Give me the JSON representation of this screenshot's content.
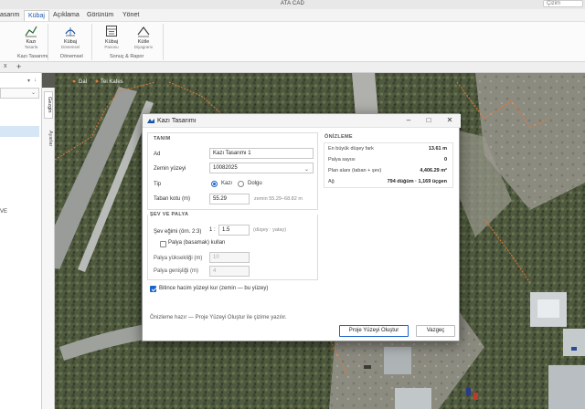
{
  "app": {
    "title": "ATA CAD",
    "search_placeholder": "Çizim"
  },
  "menu": {
    "items": [
      "asarım",
      "Kübaj",
      "Açıklama",
      "Görünüm",
      "Yönet"
    ],
    "active": "Kübaj"
  },
  "ribbon": {
    "buttons": [
      {
        "label": "Kazı",
        "sub": "Tasarla",
        "icon": "excavation-design-icon"
      },
      {
        "label": "Kübaj",
        "sub": "Dönemsel",
        "icon": "periodic-volume-icon"
      },
      {
        "label": "Kübaj",
        "sub": "Panosu",
        "icon": "volume-dashboard-icon"
      },
      {
        "label": "Kütle",
        "sub": "Diyagramı",
        "icon": "mass-haul-icon"
      }
    ],
    "groups": [
      "Kazı Tasarımı",
      "Dönemsel",
      "Sonuç & Rapor"
    ]
  },
  "tabstrip": {
    "close": "x",
    "add": "+"
  },
  "side_tabs": [
    "Gezgin",
    "Ayarlar"
  ],
  "side_text": "VE",
  "map_labels": [
    "Dal",
    "Tel Kafes"
  ],
  "dialog": {
    "title": "Kazı Tasarımı",
    "definition": {
      "header": "TANIM",
      "name_label": "Ad",
      "name_value": "Kazı Tasarımı 1",
      "ground_label": "Zemin yüzeyi",
      "ground_value": "10082025",
      "type_label": "Tip",
      "type_options": [
        "Kazı",
        "Dolgu"
      ],
      "type_selected": "Kazı",
      "bottom_label": "Taban kotu (m)",
      "bottom_value": "55.29",
      "bottom_hint": "zemin 55.29–68.82 m"
    },
    "slope": {
      "header": "ŞEV VE PALYA",
      "slope_label": "Şev eğimi (örn. 2:3)",
      "slope_prefix": "1 :",
      "slope_value": "1.5",
      "slope_hint": "(düşey : yatay)",
      "bench_label": "Palya (basamak) kullan",
      "bench_checked": false,
      "bench_height_label": "Palya yüksekliği (m)",
      "bench_height_value": "10",
      "bench_width_label": "Palya genişliği (m)",
      "bench_width_value": "4"
    },
    "volume_surface": {
      "label": "Bitince hacim yüzeyi kur (zemin — bu yüzey)",
      "checked": true
    },
    "preview": {
      "header": "ÖNİZLEME",
      "rows": [
        {
          "key": "En büyük düşey fark",
          "value": "13.61 m"
        },
        {
          "key": "Palya sayısı",
          "value": "0"
        },
        {
          "key": "Plan alanı (taban + şev)",
          "value": "4,406.29 m²"
        },
        {
          "key": "Ağ",
          "value": "794 düğüm · 1,169 üçgen"
        }
      ]
    },
    "status": "Önizleme hazır — Proje Yüzeyi Oluştur ile çizime yazılır.",
    "primary_button": "Proje Yüzeyi Oluştur",
    "cancel_button": "Vazgeç"
  }
}
